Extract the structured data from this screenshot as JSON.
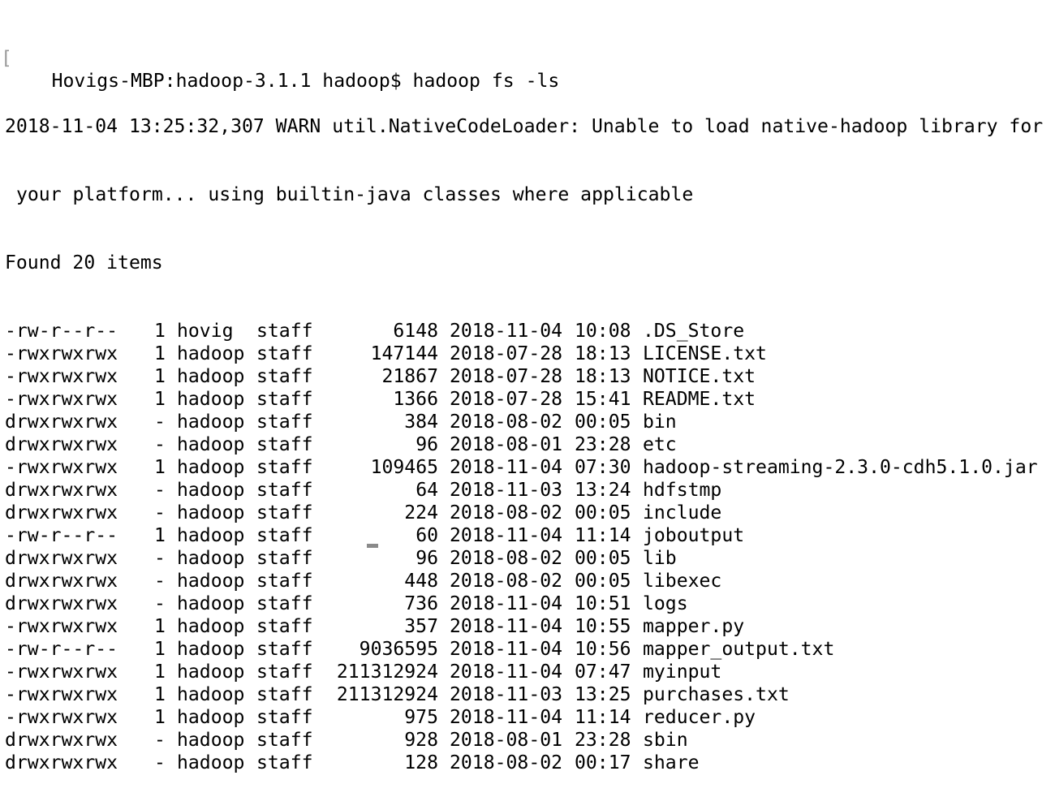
{
  "terminal": {
    "prompt_line": "Hovigs-MBP:hadoop-3.1.1 hadoop$ hadoop fs -ls",
    "warn_line1": "2018-11-04 13:25:32,307 WARN util.NativeCodeLoader: Unable to load native-hadoop library for",
    "warn_line2": "your platform... using builtin-java classes where applicable",
    "found_line": "Found 20 items",
    "listing": [
      {
        "perm": "-rw-r--r--",
        "repl": "1",
        "owner": "hovig",
        "group": "staff",
        "size": "6148",
        "date": "2018-11-04",
        "time": "10:08",
        "name": ".DS_Store"
      },
      {
        "perm": "-rwxrwxrwx",
        "repl": "1",
        "owner": "hadoop",
        "group": "staff",
        "size": "147144",
        "date": "2018-07-28",
        "time": "18:13",
        "name": "LICENSE.txt"
      },
      {
        "perm": "-rwxrwxrwx",
        "repl": "1",
        "owner": "hadoop",
        "group": "staff",
        "size": "21867",
        "date": "2018-07-28",
        "time": "18:13",
        "name": "NOTICE.txt"
      },
      {
        "perm": "-rwxrwxrwx",
        "repl": "1",
        "owner": "hadoop",
        "group": "staff",
        "size": "1366",
        "date": "2018-07-28",
        "time": "15:41",
        "name": "README.txt"
      },
      {
        "perm": "drwxrwxrwx",
        "repl": "-",
        "owner": "hadoop",
        "group": "staff",
        "size": "384",
        "date": "2018-08-02",
        "time": "00:05",
        "name": "bin"
      },
      {
        "perm": "drwxrwxrwx",
        "repl": "-",
        "owner": "hadoop",
        "group": "staff",
        "size": "96",
        "date": "2018-08-01",
        "time": "23:28",
        "name": "etc"
      },
      {
        "perm": "-rwxrwxrwx",
        "repl": "1",
        "owner": "hadoop",
        "group": "staff",
        "size": "109465",
        "date": "2018-11-04",
        "time": "07:30",
        "name": "hadoop-streaming-2.3.0-cdh5.1.0.jar"
      },
      {
        "perm": "drwxrwxrwx",
        "repl": "-",
        "owner": "hadoop",
        "group": "staff",
        "size": "64",
        "date": "2018-11-03",
        "time": "13:24",
        "name": "hdfstmp"
      },
      {
        "perm": "drwxrwxrwx",
        "repl": "-",
        "owner": "hadoop",
        "group": "staff",
        "size": "224",
        "date": "2018-08-02",
        "time": "00:05",
        "name": "include"
      },
      {
        "perm": "-rw-r--r--",
        "repl": "1",
        "owner": "hadoop",
        "group": "staff",
        "size": "60",
        "date": "2018-11-04",
        "time": "11:14",
        "name": "joboutput"
      },
      {
        "perm": "drwxrwxrwx",
        "repl": "-",
        "owner": "hadoop",
        "group": "staff",
        "size": "96",
        "date": "2018-08-02",
        "time": "00:05",
        "name": "lib"
      },
      {
        "perm": "drwxrwxrwx",
        "repl": "-",
        "owner": "hadoop",
        "group": "staff",
        "size": "448",
        "date": "2018-08-02",
        "time": "00:05",
        "name": "libexec"
      },
      {
        "perm": "drwxrwxrwx",
        "repl": "-",
        "owner": "hadoop",
        "group": "staff",
        "size": "736",
        "date": "2018-11-04",
        "time": "10:51",
        "name": "logs"
      },
      {
        "perm": "-rwxrwxrwx",
        "repl": "1",
        "owner": "hadoop",
        "group": "staff",
        "size": "357",
        "date": "2018-11-04",
        "time": "10:55",
        "name": "mapper.py"
      },
      {
        "perm": "-rw-r--r--",
        "repl": "1",
        "owner": "hadoop",
        "group": "staff",
        "size": "9036595",
        "date": "2018-11-04",
        "time": "10:56",
        "name": "mapper_output.txt"
      },
      {
        "perm": "-rwxrwxrwx",
        "repl": "1",
        "owner": "hadoop",
        "group": "staff",
        "size": "211312924",
        "date": "2018-11-04",
        "time": "07:47",
        "name": "myinput"
      },
      {
        "perm": "-rwxrwxrwx",
        "repl": "1",
        "owner": "hadoop",
        "group": "staff",
        "size": "211312924",
        "date": "2018-11-03",
        "time": "13:25",
        "name": "purchases.txt"
      },
      {
        "perm": "-rwxrwxrwx",
        "repl": "1",
        "owner": "hadoop",
        "group": "staff",
        "size": "975",
        "date": "2018-11-04",
        "time": "11:14",
        "name": "reducer.py"
      },
      {
        "perm": "drwxrwxrwx",
        "repl": "-",
        "owner": "hadoop",
        "group": "staff",
        "size": "928",
        "date": "2018-08-01",
        "time": "23:28",
        "name": "sbin"
      },
      {
        "perm": "drwxrwxrwx",
        "repl": "-",
        "owner": "hadoop",
        "group": "staff",
        "size": "128",
        "date": "2018-08-02",
        "time": "00:17",
        "name": "share"
      }
    ]
  }
}
